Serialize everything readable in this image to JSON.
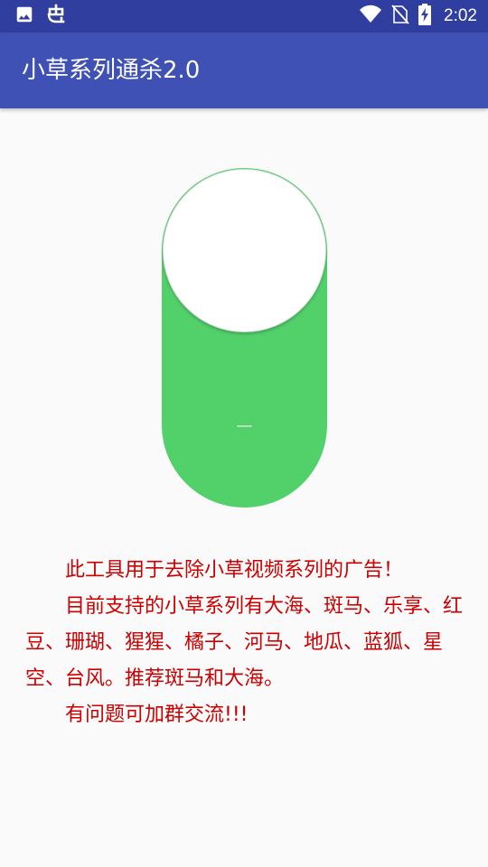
{
  "status_bar": {
    "time": "2:02",
    "left_icons": [
      "image-icon",
      "bug-icon"
    ],
    "right_icons": [
      "wifi-icon",
      "no-sim-icon",
      "battery-charging-icon"
    ]
  },
  "app_bar": {
    "title": "小草系列通杀2.0"
  },
  "toggle": {
    "state": "on",
    "mark": "—",
    "track_color": "#52d16b",
    "knob_color": "#ffffff"
  },
  "description": {
    "color": "#cc0000",
    "paragraphs": [
      "此工具用于去除小草视频系列的广告！",
      "目前支持的小草系列有大海、斑马、乐享、红豆、珊瑚、猩猩、橘子、河马、地瓜、蓝狐、星空、台风。推荐斑马和大海。",
      "有问题可加群交流!!!"
    ]
  },
  "colors": {
    "status_bar": "#303f9f",
    "app_bar": "#3f51b5",
    "background": "#fafafa"
  }
}
